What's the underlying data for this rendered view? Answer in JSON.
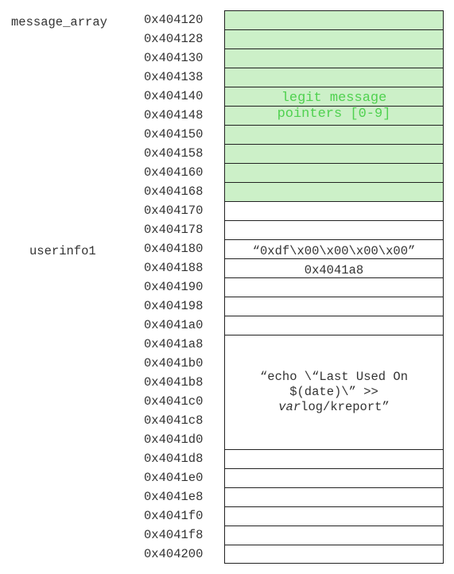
{
  "labels": {
    "message_array": "message_array",
    "userinfo1": "userinfo1"
  },
  "addresses": [
    "0x404120",
    "0x404128",
    "0x404130",
    "0x404138",
    "0x404140",
    "0x404148",
    "0x404150",
    "0x404158",
    "0x404160",
    "0x404168",
    "0x404170",
    "0x404178",
    "0x404180",
    "0x404188",
    "0x404190",
    "0x404198",
    "0x4041a0",
    "0x4041a8",
    "0x4041b0",
    "0x4041b8",
    "0x4041c0",
    "0x4041c8",
    "0x4041d0",
    "0x4041d8",
    "0x4041e0",
    "0x4041e8",
    "0x4041f0",
    "0x4041f8",
    "0x404200"
  ],
  "cells": {
    "legit_line1": "legit message",
    "legit_line2": "pointers [0-9]",
    "userinfo_value": "“0xdf\\x00\\x00\\x00\\x00”",
    "pointer_value": "0x4041a8",
    "cmd_line1": "“echo \\“Last Used On",
    "cmd_line2": "$(date)\\” >>",
    "cmd_line3_italic": "var",
    "cmd_line3_rest": "log/kreport”"
  },
  "colors": {
    "message_fill": "#ccf0c8",
    "message_text": "#4fd14f",
    "border": "#222222",
    "text": "#333333"
  }
}
